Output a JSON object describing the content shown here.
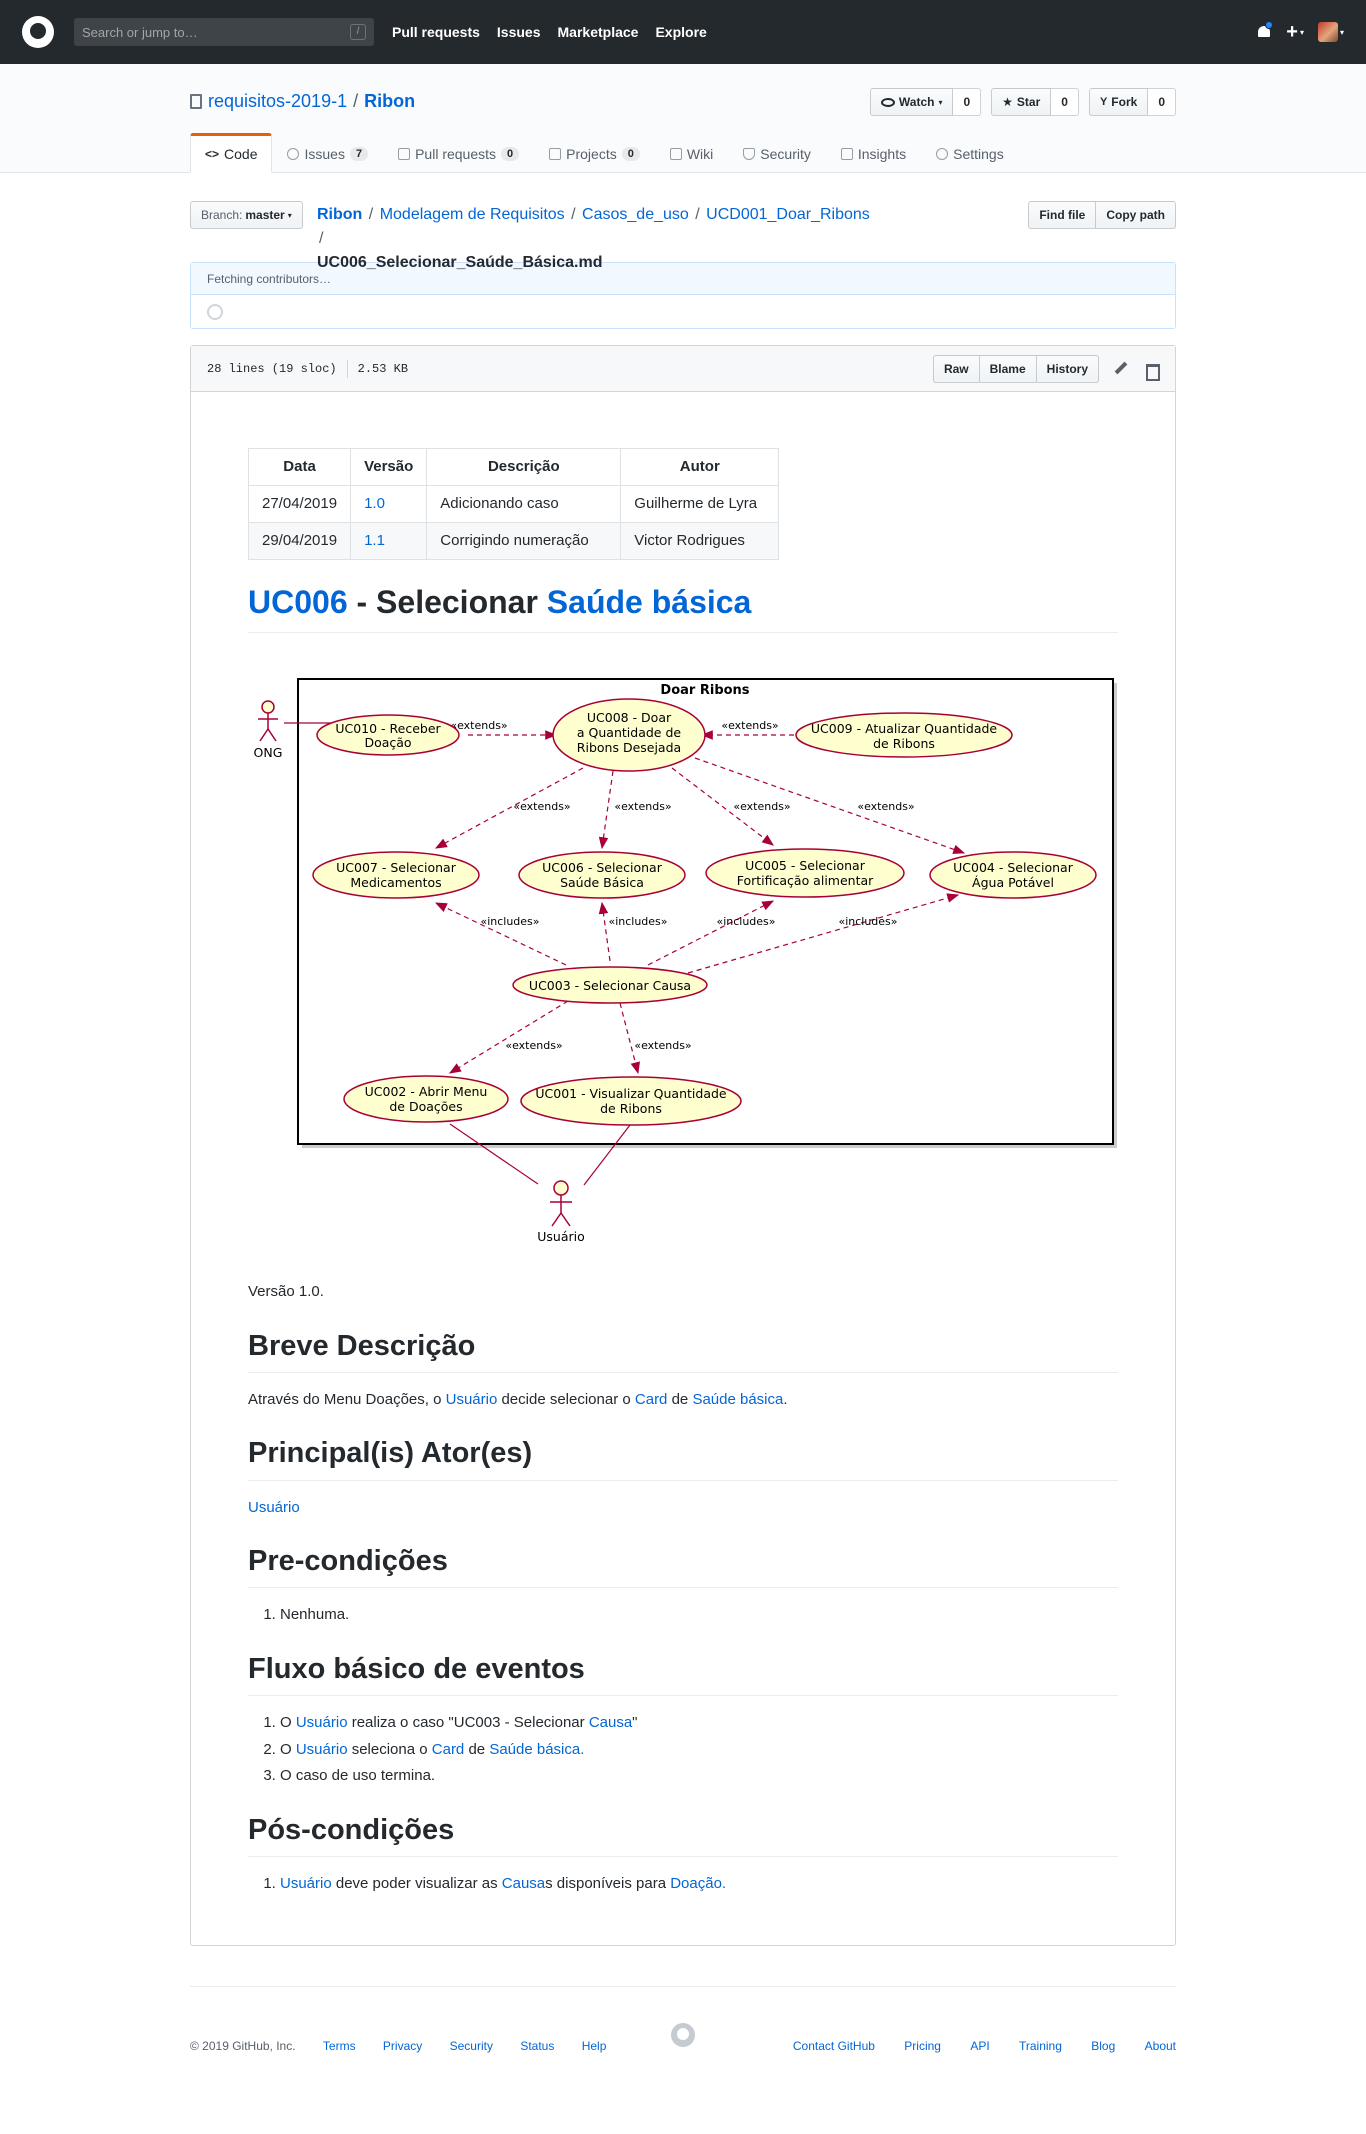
{
  "header": {
    "search_placeholder": "Search or jump to…",
    "slash": "/",
    "nav": [
      "Pull requests",
      "Issues",
      "Marketplace",
      "Explore"
    ],
    "plus": "+",
    "caret": "▾"
  },
  "repo": {
    "owner": "requisitos-2019-1",
    "sep": "/",
    "name": "Ribon",
    "watch_label": "Watch",
    "watch_count": "0",
    "star_label": "Star",
    "star_count": "0",
    "fork_label": "Fork",
    "fork_count": "0"
  },
  "tabs": {
    "code": "Code",
    "issues": "Issues",
    "issues_count": "7",
    "pulls": "Pull requests",
    "pulls_count": "0",
    "projects": "Projects",
    "projects_count": "0",
    "wiki": "Wiki",
    "security": "Security",
    "insights": "Insights",
    "settings": "Settings"
  },
  "file_nav": {
    "branch_label": "Branch:",
    "branch": "master",
    "crumbs": [
      "Ribon",
      "Modelagem de Requisitos",
      "Casos_de_uso",
      "UCD001_Doar_Ribons"
    ],
    "sep": "/",
    "filename": "UC006_Selecionar_Saúde_Básica.md",
    "find_file": "Find file",
    "copy_path": "Copy path"
  },
  "commit": {
    "fetching": "Fetching contributors…"
  },
  "file_header": {
    "lines": "28 lines (19 sloc)",
    "size": "2.53 KB",
    "raw": "Raw",
    "blame": "Blame",
    "history": "History"
  },
  "version_table": {
    "headers": [
      "Data",
      "Versão",
      "Descrição",
      "Autor"
    ],
    "rows": [
      [
        "27/04/2019",
        "1.0",
        "Adicionando caso",
        "Guilherme de Lyra"
      ],
      [
        "29/04/2019",
        "1.1",
        "Corrigindo numeração",
        "Victor Rodrigues"
      ]
    ]
  },
  "title": {
    "uc": "UC006",
    "dash": " - Selecionar ",
    "topic": "Saúde básica"
  },
  "diagram": {
    "package": "Doar Ribons",
    "actor_ong": "ONG",
    "actor_user": "Usuário",
    "uc010": [
      "UC010 - Receber",
      "Doação"
    ],
    "uc008": [
      "UC008 - Doar",
      "a Quantidade de",
      "Ribons Desejada"
    ],
    "uc009": [
      "UC009 - Atualizar Quantidade",
      "de Ribons"
    ],
    "uc007": [
      "UC007 - Selecionar",
      "Medicamentos"
    ],
    "uc006": [
      "UC006 - Selecionar",
      "Saúde Básica"
    ],
    "uc005": [
      "UC005 - Selecionar",
      "Fortificação alimentar"
    ],
    "uc004": [
      "UC004 - Selecionar",
      "Água Potável"
    ],
    "uc003": [
      "UC003 - Selecionar Causa"
    ],
    "uc002": [
      "UC002 - Abrir Menu",
      "de Doações"
    ],
    "uc001": [
      "UC001 - Visualizar Quantidade",
      "de Ribons"
    ],
    "extends": "«extends»",
    "includes": "«includes»"
  },
  "content": {
    "version": "Versão 1.0.",
    "h_desc": "Breve Descrição",
    "desc_1": "Através do Menu Doações, o ",
    "desc_user": "Usuário",
    "desc_2": " decide selecionar o ",
    "desc_card": "Card",
    "desc_3": " de ",
    "desc_saude": "Saúde básica",
    "desc_4": ".",
    "h_actors": "Principal(is) Ator(es)",
    "actor": "Usuário",
    "h_pre": "Pre-condições",
    "pre": [
      "Nenhuma."
    ],
    "h_flow": "Fluxo básico de eventos",
    "flow1_a": "O ",
    "flow1_user": "Usuário",
    "flow1_b": " realiza o caso \"UC003 - Selecionar ",
    "flow1_causa": "Causa",
    "flow1_c": "\"",
    "flow2_a": "O ",
    "flow2_user": "Usuário",
    "flow2_b": " seleciona o ",
    "flow2_card": "Card",
    "flow2_c": " de ",
    "flow2_saude": "Saúde básica.",
    "flow3": "O caso de uso termina.",
    "h_post": "Pós-condições",
    "post_user": "Usuário",
    "post_a": " deve poder visualizar as ",
    "post_causa": "Causa",
    "post_b": "s disponíveis para ",
    "post_doacao": "Doação."
  },
  "footer": {
    "copy": "© 2019 GitHub, Inc.",
    "left_links": [
      "Terms",
      "Privacy",
      "Security",
      "Status",
      "Help"
    ],
    "right_links": [
      "Contact GitHub",
      "Pricing",
      "API",
      "Training",
      "Blog",
      "About"
    ]
  },
  "colors": {
    "header_bg": "#24292e",
    "link": "#0366d6",
    "tab_accent": "#e36209",
    "uml_fill": "#fefece",
    "uml_line": "#a80036"
  }
}
